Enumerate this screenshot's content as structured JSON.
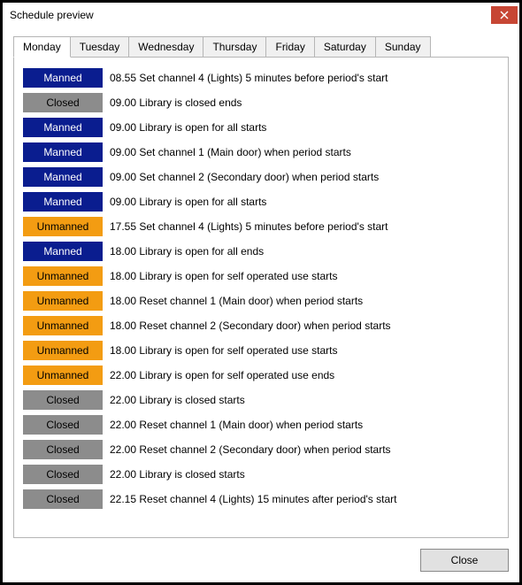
{
  "window": {
    "title": "Schedule preview",
    "close_label": "Close"
  },
  "tabs": [
    {
      "label": "Monday",
      "active": true
    },
    {
      "label": "Tuesday",
      "active": false
    },
    {
      "label": "Wednesday",
      "active": false
    },
    {
      "label": "Thursday",
      "active": false
    },
    {
      "label": "Friday",
      "active": false
    },
    {
      "label": "Saturday",
      "active": false
    },
    {
      "label": "Sunday",
      "active": false
    }
  ],
  "status_labels": {
    "manned": "Manned",
    "unmanned": "Unmanned",
    "closed": "Closed"
  },
  "rows": [
    {
      "status": "manned",
      "time": "08.55",
      "text": "Set channel 4 (Lights) 5 minutes before period's start"
    },
    {
      "status": "closed",
      "time": "09.00",
      "text": "Library is closed ends"
    },
    {
      "status": "manned",
      "time": "09.00",
      "text": "Library is open for all starts"
    },
    {
      "status": "manned",
      "time": "09.00",
      "text": "Set channel 1 (Main door) when period starts"
    },
    {
      "status": "manned",
      "time": "09.00",
      "text": "Set channel 2 (Secondary door) when period starts"
    },
    {
      "status": "manned",
      "time": "09.00",
      "text": "Library is open for all starts"
    },
    {
      "status": "unmanned",
      "time": "17.55",
      "text": "Set channel 4 (Lights) 5 minutes before period's start"
    },
    {
      "status": "manned",
      "time": "18.00",
      "text": "Library is open for all ends"
    },
    {
      "status": "unmanned",
      "time": "18.00",
      "text": "Library is open for self operated use starts"
    },
    {
      "status": "unmanned",
      "time": "18.00",
      "text": "Reset channel 1 (Main door) when period starts"
    },
    {
      "status": "unmanned",
      "time": "18.00",
      "text": "Reset channel 2 (Secondary door) when period starts"
    },
    {
      "status": "unmanned",
      "time": "18.00",
      "text": "Library is open for self operated use starts"
    },
    {
      "status": "unmanned",
      "time": "22.00",
      "text": "Library is open for self operated use ends"
    },
    {
      "status": "closed",
      "time": "22.00",
      "text": "Library is closed starts"
    },
    {
      "status": "closed",
      "time": "22.00",
      "text": "Reset channel 1 (Main door) when period starts"
    },
    {
      "status": "closed",
      "time": "22.00",
      "text": "Reset channel 2 (Secondary door) when period starts"
    },
    {
      "status": "closed",
      "time": "22.00",
      "text": "Library is closed starts"
    },
    {
      "status": "closed",
      "time": "22.15",
      "text": "Reset channel 4 (Lights) 15 minutes after period's start"
    }
  ]
}
